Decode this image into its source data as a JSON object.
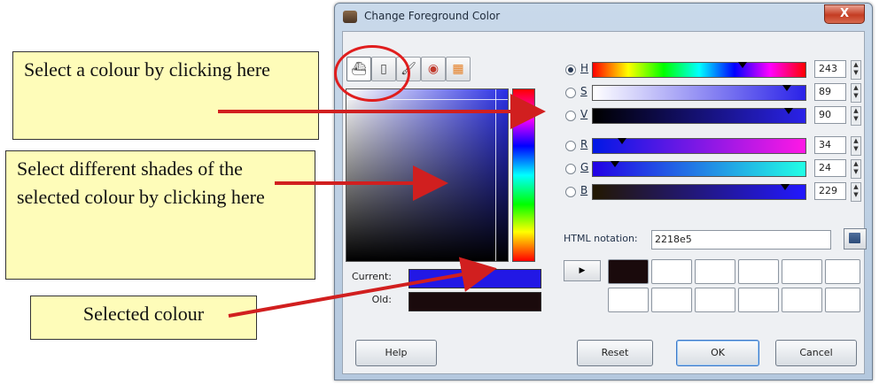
{
  "dialog": {
    "title": "Change Foreground Color",
    "close_label": "X",
    "tools": [
      "gimp-selector-icon",
      "watercolor-icon",
      "brush-icon",
      "color-wheel-icon",
      "palette-icon"
    ],
    "swatches": {
      "current_label": "Current:",
      "old_label": "Old:",
      "current_color": "#2218e5",
      "old_color": "#1a0a0c"
    },
    "channels": [
      {
        "key": "H",
        "value": "243",
        "selected": true
      },
      {
        "key": "S",
        "value": "89",
        "selected": false
      },
      {
        "key": "V",
        "value": "90",
        "selected": false
      },
      {
        "key": "R",
        "value": "34",
        "selected": false
      },
      {
        "key": "G",
        "value": "24",
        "selected": false
      },
      {
        "key": "B",
        "value": "229",
        "selected": false
      }
    ],
    "html_notation_label": "HTML notation:",
    "html_notation_value": "2218e5",
    "history_first_color": "#1a0a0c",
    "buttons": {
      "help": "Help",
      "reset": "Reset",
      "ok": "OK",
      "cancel": "Cancel"
    }
  },
  "annotations": {
    "select_colour": "Select a colour by clicking here",
    "select_shades": "Select different shades of the selected colour by clicking here",
    "selected_colour": "Selected colour"
  },
  "colors": {
    "accent_arrow": "#d11f1f",
    "callout_bg": "#fefcb9"
  }
}
